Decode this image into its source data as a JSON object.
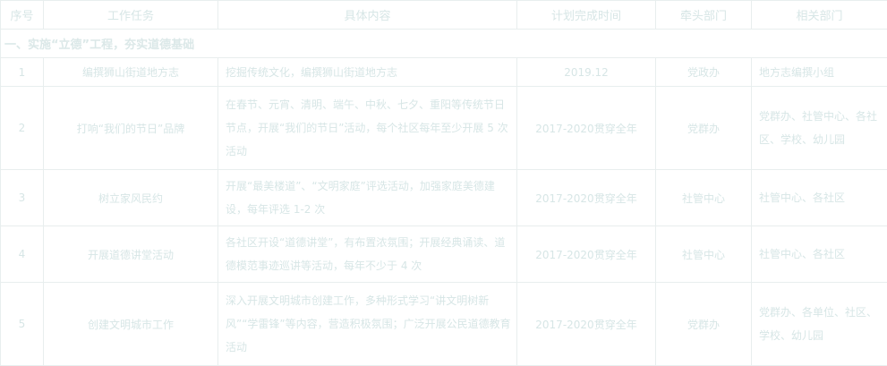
{
  "table": {
    "headers": [
      "序号",
      "工作任务",
      "具体内容",
      "计划完成时间",
      "牵头部门",
      "相关部门"
    ],
    "section_title": "一、实施“立德”工程，夯实道德基础",
    "rows": [
      {
        "num": "1",
        "task": "编撰狮山街道地方志",
        "content": "挖掘传统文化，编撰狮山街道地方志",
        "time": "2019.12",
        "lead": "党政办",
        "related": "地方志编撰小组"
      },
      {
        "num": "2",
        "task": "打响“我们的节日”品牌",
        "content": "在春节、元宵、清明、端午、中秋、七夕、重阳等传统节日节点，开展“我们的节日”活动，每个社区每年至少开展 5 次活动",
        "time": "2017-2020贯穿全年",
        "lead": "党群办",
        "related": "党群办、社管中心、各社区、学校、幼儿园"
      },
      {
        "num": "3",
        "task": "树立家风民约",
        "content": "开展“最美楼道”、“文明家庭”评选活动，加强家庭美德建设，每年评选 1-2 次",
        "time": "2017-2020贯穿全年",
        "lead": "社管中心",
        "related": "社管中心、各社区"
      },
      {
        "num": "4",
        "task": "开展道德讲堂活动",
        "content": "各社区开设“道德讲堂”，有布置浓氛围；开展经典诵读、道德模范事迹巡讲等活动，每年不少于 4 次",
        "time": "2017-2020贯穿全年",
        "lead": "社管中心",
        "related": "社管中心、各社区"
      },
      {
        "num": "5",
        "task": "创建文明城市工作",
        "content": "深入开展文明城市创建工作，多种形式学习“讲文明树新风”“学雷锋”等内容，营造积极氛围；广泛开展公民道德教育活动",
        "time": "2017-2020贯穿全年",
        "lead": "党群办",
        "related": "党群办、各单位、社区、学校、幼儿园"
      }
    ]
  }
}
